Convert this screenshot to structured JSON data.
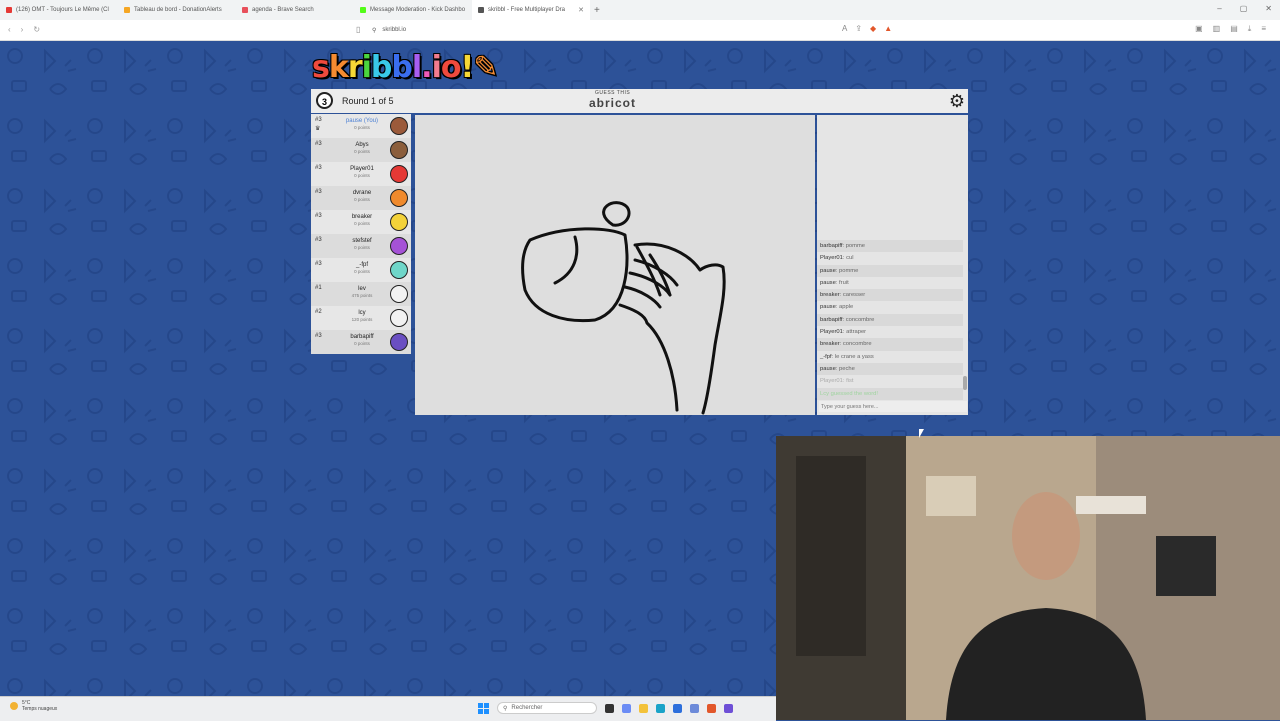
{
  "browser": {
    "tabs": [
      {
        "title": "(126) OMT - Toujours Le Même (Cl",
        "color": "#e53935"
      },
      {
        "title": "Tableau de bord - DonationAlerts",
        "color": "#f5a623"
      },
      {
        "title": "agenda - Brave Search",
        "color": "#e8505b"
      },
      {
        "title": "Message Moderation - Kick Dashbo",
        "color": "#53fc18"
      },
      {
        "title": "skribbl - Free Multiplayer Dra",
        "color": "#555555",
        "active": true
      }
    ],
    "url": "skribbl.io"
  },
  "game": {
    "logo": "skribbl.io",
    "round_number": "3",
    "round_label": "Round 1 of 5",
    "guess_label": "GUESS THIS",
    "word_hint": "abricot",
    "players": [
      {
        "rank": "#3",
        "name": "pause (You)",
        "score": "0 points",
        "you": true,
        "avatar_color": "#9b5a3a"
      },
      {
        "rank": "#3",
        "name": "Abys",
        "score": "0 points",
        "avatar_color": "#8b5e3c"
      },
      {
        "rank": "#3",
        "name": "Player01",
        "score": "0 points",
        "avatar_color": "#e53935"
      },
      {
        "rank": "#3",
        "name": "dvrane",
        "score": "0 points",
        "avatar_color": "#f08a2c"
      },
      {
        "rank": "#3",
        "name": "breaker",
        "score": "0 points",
        "avatar_color": "#f3d23a"
      },
      {
        "rank": "#3",
        "name": "stefstef",
        "score": "0 points",
        "avatar_color": "#a552d6"
      },
      {
        "rank": "#3",
        "name": "_-fpf",
        "score": "0 points",
        "avatar_color": "#6fd6c9"
      },
      {
        "rank": "#1",
        "name": "lev",
        "score": "475 points",
        "avatar_color": "#f2f2f2"
      },
      {
        "rank": "#2",
        "name": "lcy",
        "score": "120 points",
        "avatar_color": "#f2f2f2"
      },
      {
        "rank": "#3",
        "name": "barbapiff",
        "score": "0 points",
        "avatar_color": "#6a4fc2"
      }
    ],
    "bubbles": [
      "peche",
      "fist"
    ],
    "chat": [
      {
        "user": "barbapiff",
        "text": "pomme"
      },
      {
        "user": "Player01",
        "text": "cul"
      },
      {
        "user": "pause",
        "text": "pomme"
      },
      {
        "user": "pause",
        "text": "fruit"
      },
      {
        "user": "breaker",
        "text": "caresser"
      },
      {
        "user": "pause",
        "text": "apple"
      },
      {
        "user": "barbapiff",
        "text": "concombre"
      },
      {
        "user": "Player01",
        "text": "attraper"
      },
      {
        "user": "breaker",
        "text": "concombre"
      },
      {
        "user": "_-fpf",
        "text": "le crane a yass"
      },
      {
        "user": "pause",
        "text": "peche"
      },
      {
        "user": "Player01",
        "text": "fist",
        "faded": true
      }
    ],
    "chat_status": "Lcy guessed the word!",
    "chat_placeholder": "Type your guess here..."
  },
  "taskbar": {
    "weather_temp": "5°C",
    "weather_desc": "Temps nuageux",
    "search_label": "Rechercher"
  }
}
